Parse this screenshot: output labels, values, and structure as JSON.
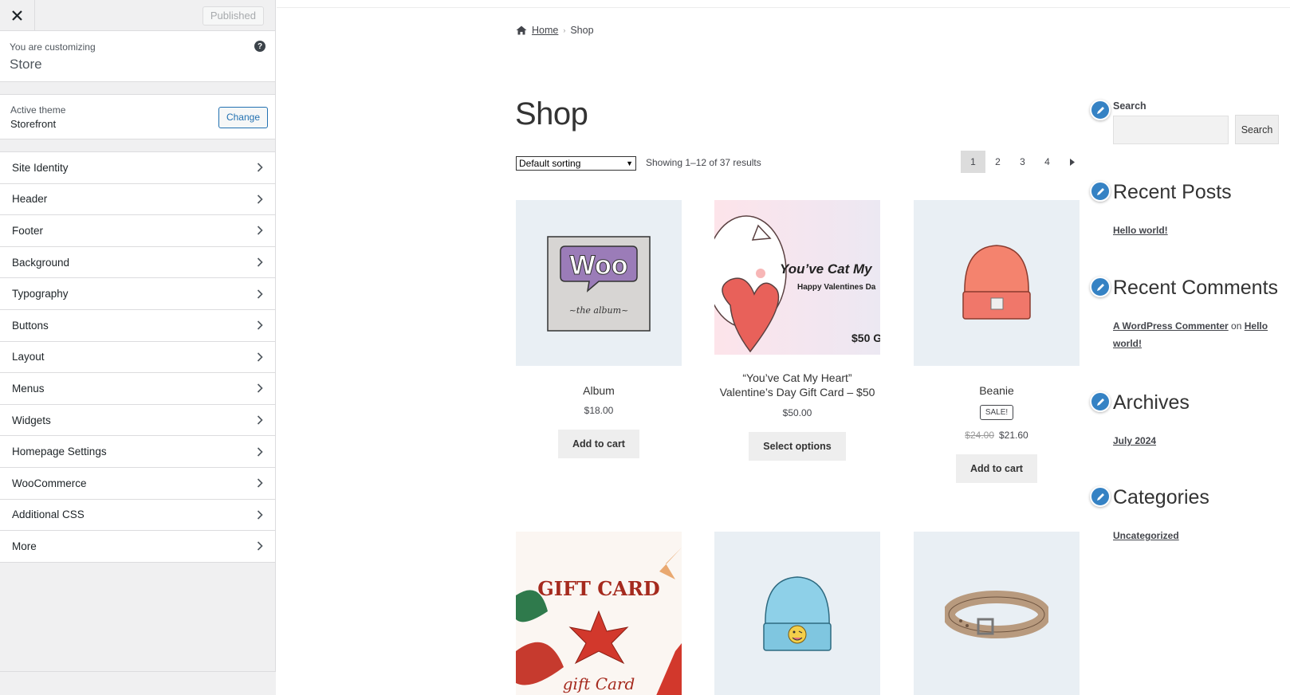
{
  "sidebar": {
    "published_label": "Published",
    "customizing_label": "You are customizing",
    "customizing_value": "Store",
    "help_icon": "?",
    "active_theme_label": "Active theme",
    "active_theme_value": "Storefront",
    "change_label": "Change",
    "panels": [
      {
        "label": "Site Identity"
      },
      {
        "label": "Header"
      },
      {
        "label": "Footer"
      },
      {
        "label": "Background"
      },
      {
        "label": "Typography"
      },
      {
        "label": "Buttons"
      },
      {
        "label": "Layout"
      },
      {
        "label": "Menus"
      },
      {
        "label": "Widgets"
      },
      {
        "label": "Homepage Settings"
      },
      {
        "label": "WooCommerce"
      },
      {
        "label": "Additional CSS"
      },
      {
        "label": "More"
      }
    ]
  },
  "preview": {
    "breadcrumb": {
      "home": "Home",
      "current": "Shop"
    },
    "title": "Shop",
    "sort": "Default sorting",
    "result_count": "Showing 1–12 of 37 results",
    "pages": [
      "1",
      "2",
      "3",
      "4"
    ],
    "products": [
      {
        "name": "Album",
        "price": "$18.00",
        "button": "Add to cart"
      },
      {
        "name": "“You’ve Cat My Heart” Valentine’s Day Gift Card – $50",
        "price": "$50.00",
        "button": "Select options",
        "img_title": "You’ve Cat My",
        "img_sub": "Happy Valentines Da",
        "img_price": "$50 G"
      },
      {
        "name": "Beanie",
        "badge": "SALE!",
        "old_price": "$24.00",
        "price": "$21.60",
        "button": "Add to cart"
      },
      {
        "img_title": "GIFT CARD",
        "img_sub": "gift Card"
      },
      {},
      {}
    ],
    "album_art": {
      "logo": "Woo",
      "caption": "~the album~"
    },
    "widgets": {
      "search_label": "Search",
      "search_button": "Search",
      "recent_posts_title": "Recent Posts",
      "recent_post": "Hello world!",
      "recent_comments_title": "Recent Comments",
      "commenter": "A WordPress Commenter",
      "comment_on": "on",
      "comment_post": "Hello world!",
      "archives_title": "Archives",
      "archive": "July 2024",
      "categories_title": "Categories",
      "category": "Uncategorized"
    }
  },
  "colors": {
    "accent": "#2271b1",
    "edit_shortcut": "#3582c4"
  }
}
